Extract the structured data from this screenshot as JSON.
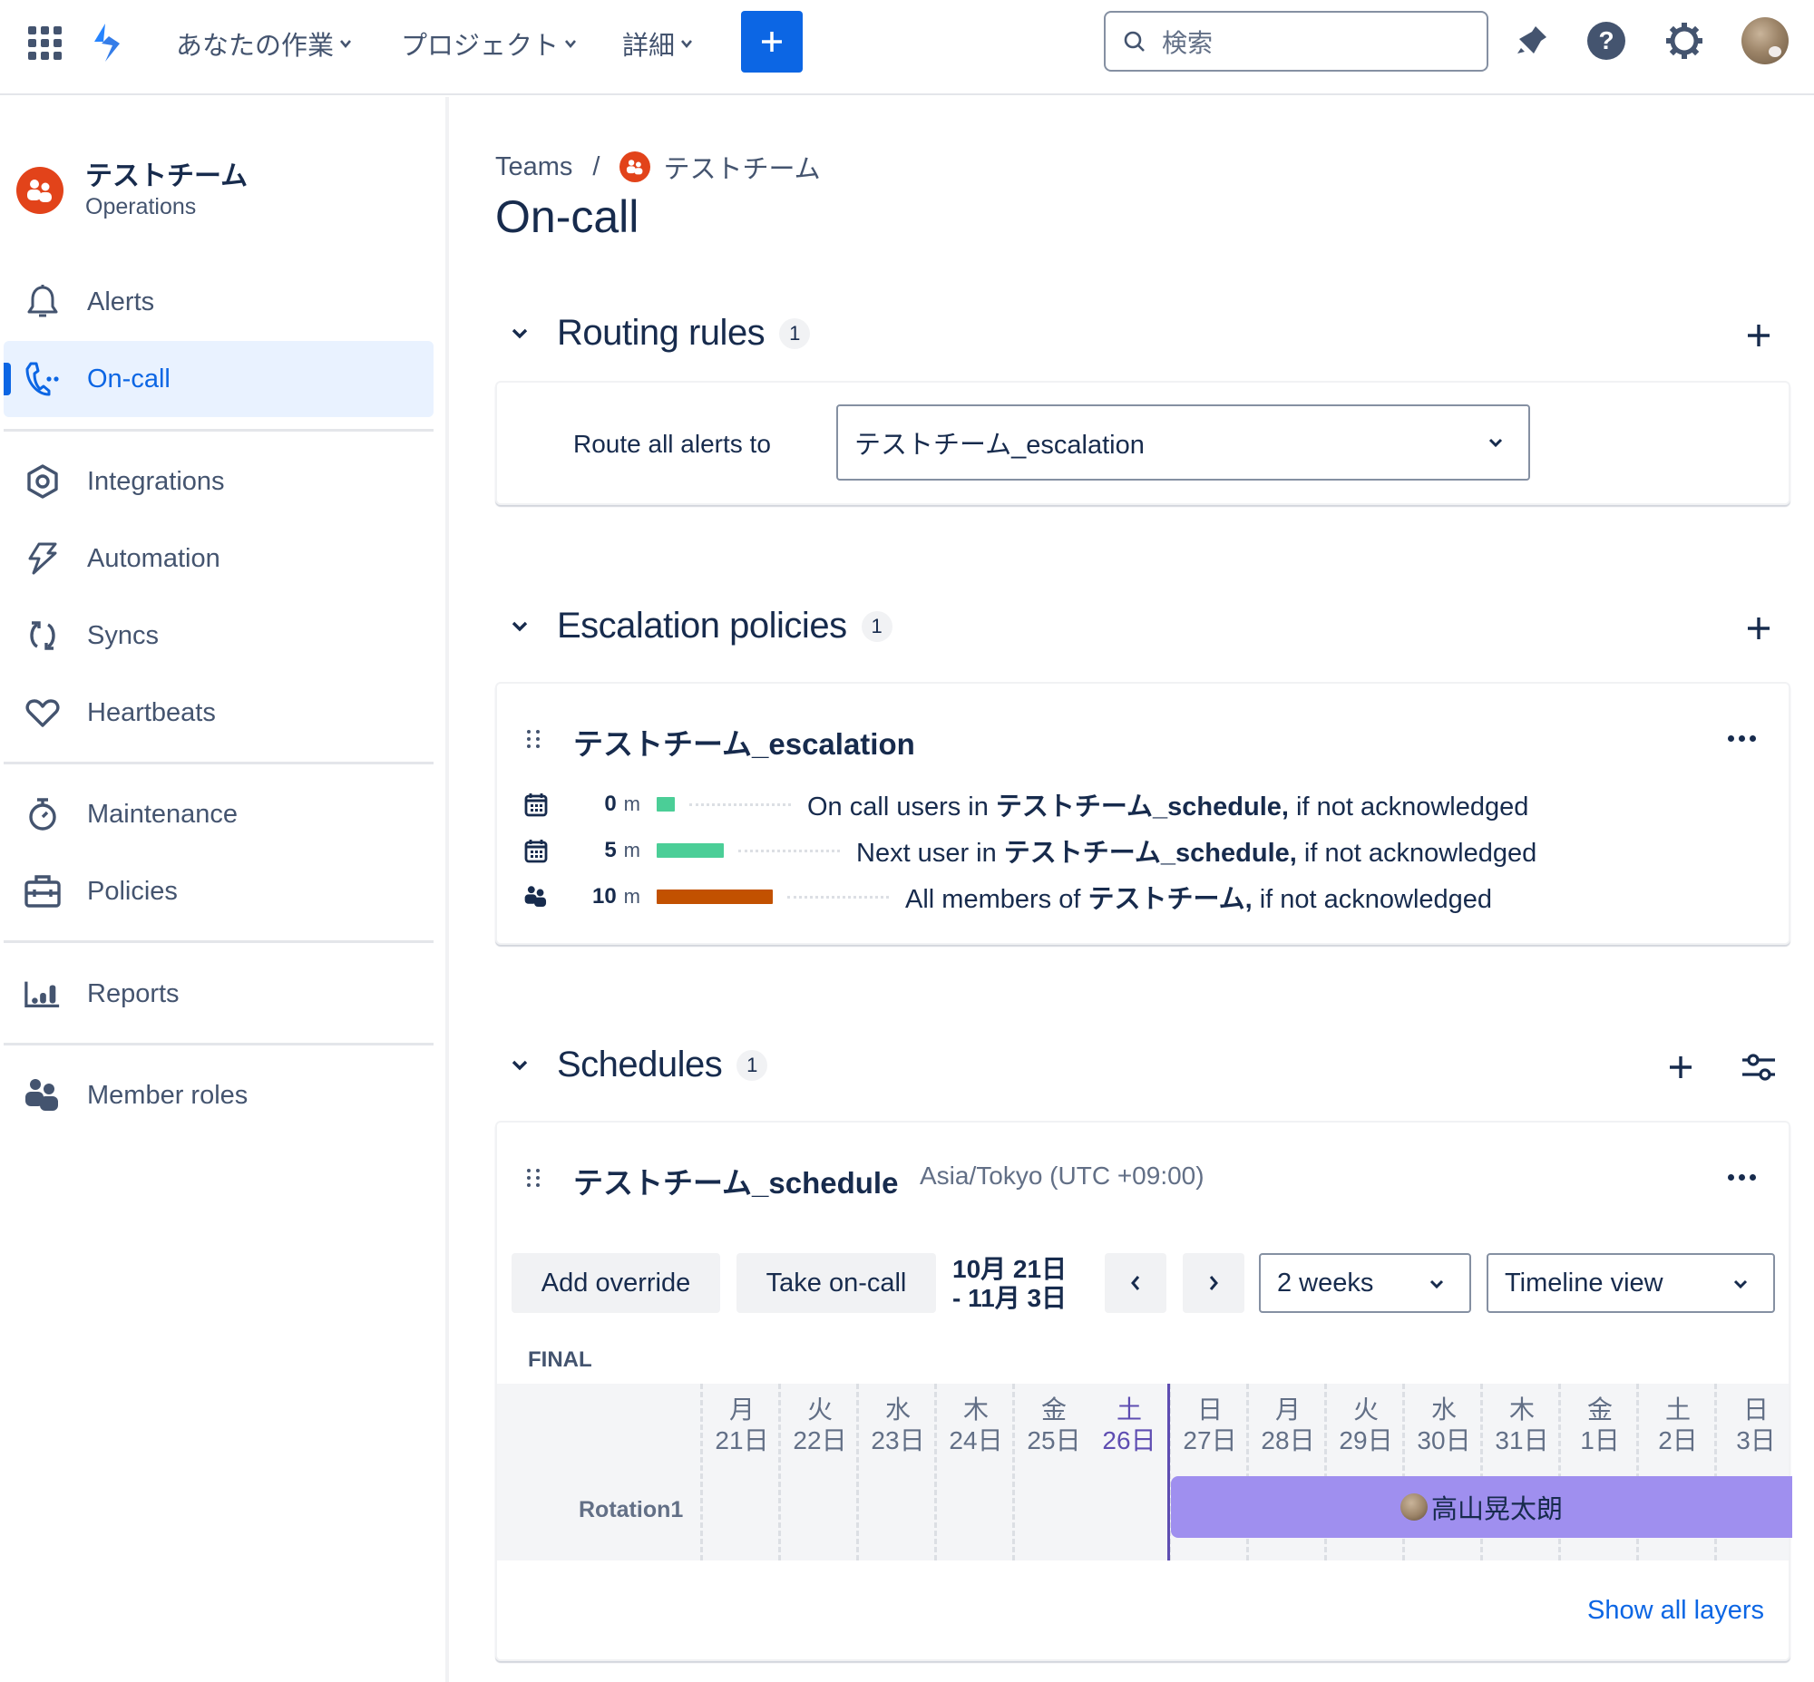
{
  "topnav": {
    "menus": [
      {
        "label": "あなたの作業"
      },
      {
        "label": "プロジェクト"
      },
      {
        "label": "詳細"
      }
    ],
    "create_label": "+",
    "search": {
      "placeholder": "検索",
      "value": ""
    },
    "icons": [
      "app-switcher-icon",
      "product-logo-icon",
      "notifications-icon",
      "help-icon",
      "settings-icon",
      "profile-avatar"
    ]
  },
  "sidebar": {
    "team": {
      "name": "テストチーム",
      "type": "Operations"
    },
    "items": [
      {
        "label": "Alerts",
        "icon": "bell-icon",
        "active": false
      },
      {
        "label": "On-call",
        "icon": "on-call-icon",
        "active": true
      },
      {
        "label": "Integrations",
        "icon": "integrations-icon",
        "active": false
      },
      {
        "label": "Automation",
        "icon": "automation-icon",
        "active": false
      },
      {
        "label": "Syncs",
        "icon": "syncs-icon",
        "active": false
      },
      {
        "label": "Heartbeats",
        "icon": "heart-icon",
        "active": false
      },
      {
        "label": "Maintenance",
        "icon": "stopwatch-icon",
        "active": false
      },
      {
        "label": "Policies",
        "icon": "toolbox-icon",
        "active": false
      },
      {
        "label": "Reports",
        "icon": "chart-icon",
        "active": false
      },
      {
        "label": "Member roles",
        "icon": "people-icon",
        "active": false
      }
    ]
  },
  "breadcrumb": {
    "root": "Teams",
    "separator": "/",
    "team": "テストチーム"
  },
  "page_title": "On-call",
  "routing": {
    "title": "Routing rules",
    "count": "1",
    "label": "Route all alerts to",
    "selected": "テストチーム_escalation"
  },
  "escalation": {
    "title": "Escalation policies",
    "count": "1",
    "policy_name": "テストチーム_escalation",
    "steps": [
      {
        "delay": "0",
        "unit": "m",
        "icon": "calendar-icon",
        "bar_color": "#4bce97",
        "delay_minutes": 0,
        "prefix": "On call users in ",
        "target": "テストチーム_schedule,",
        "suffix": " if not acknowledged"
      },
      {
        "delay": "5",
        "unit": "m",
        "icon": "calendar-icon",
        "bar_color": "#4bce97",
        "delay_minutes": 5,
        "prefix": "Next user in ",
        "target": "テストチーム_schedule,",
        "suffix": " if not acknowledged"
      },
      {
        "delay": "10",
        "unit": "m",
        "icon": "people-icon",
        "bar_color": "#c25100",
        "delay_minutes": 10,
        "prefix": "All members of ",
        "target": "テストチーム,",
        "suffix": " if not acknowledged"
      }
    ]
  },
  "schedules": {
    "title": "Schedules",
    "count": "1",
    "schedule_name": "テストチーム_schedule",
    "timezone": "Asia/Tokyo (UTC +09:00)",
    "add_override": "Add override",
    "take_on_call": "Take on-call",
    "range_line1": "10月 21日",
    "range_line2": "- 11月 3日",
    "prev_label": "‹",
    "next_label": "›",
    "interval": "2 weeks",
    "view": "Timeline view",
    "final_label": "FINAL",
    "rotation_label": "Rotation1",
    "days": [
      {
        "dow": "月",
        "date": "21日"
      },
      {
        "dow": "火",
        "date": "22日"
      },
      {
        "dow": "水",
        "date": "23日"
      },
      {
        "dow": "木",
        "date": "24日"
      },
      {
        "dow": "金",
        "date": "25日"
      },
      {
        "dow": "土",
        "date": "26日",
        "today": true
      },
      {
        "dow": "日",
        "date": "27日"
      },
      {
        "dow": "月",
        "date": "28日"
      },
      {
        "dow": "火",
        "date": "29日"
      },
      {
        "dow": "水",
        "date": "30日"
      },
      {
        "dow": "木",
        "date": "31日"
      },
      {
        "dow": "金",
        "date": "1日"
      },
      {
        "dow": "土",
        "date": "2日"
      },
      {
        "dow": "日",
        "date": "3日"
      }
    ],
    "shift": {
      "user": "高山晃太朗",
      "start_day_index": 6,
      "end_day_index": 14,
      "color": "#9f8fef"
    },
    "show_all_layers": "Show all layers"
  },
  "colors": {
    "accent": "#0c66e4",
    "team": "#e2431a",
    "today": "#5e4db2"
  }
}
